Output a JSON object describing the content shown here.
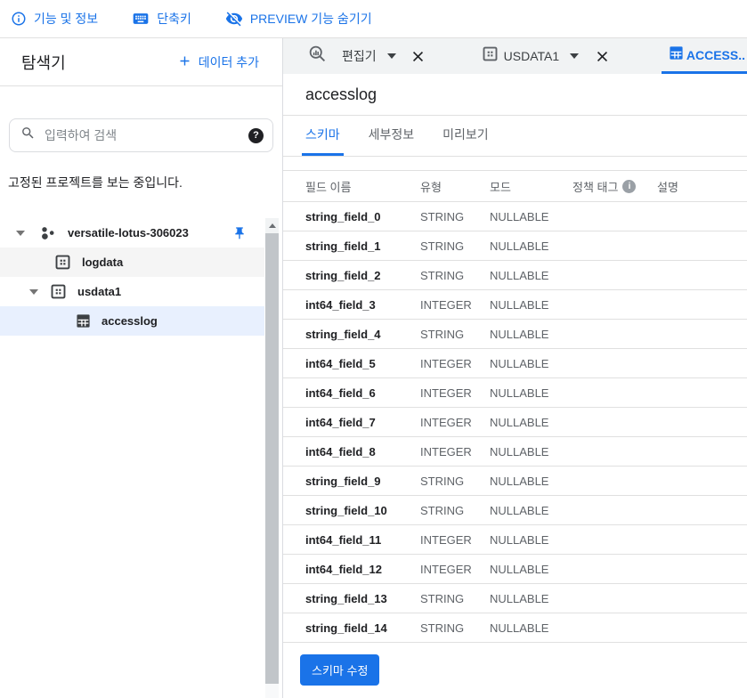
{
  "topbar": {
    "items": [
      {
        "label": "기능 및 정보",
        "icon": "info-icon"
      },
      {
        "label": "단축키",
        "icon": "keyboard-icon"
      },
      {
        "label": "PREVIEW 기능 숨기기",
        "icon": "eye-off-icon"
      }
    ]
  },
  "explorer": {
    "title": "탐색기",
    "add_data_label": "데이터 추가",
    "search": {
      "placeholder": "입력하여 검색"
    },
    "pinned_message": "고정된 프로젝트를 보는 중입니다.",
    "tree": {
      "project_label": "versatile-lotus-306023",
      "dataset_1": "logdata",
      "dataset_2": "usdata1",
      "table_1": "accesslog"
    }
  },
  "workspace_tabs": {
    "editor_label": "편집기",
    "dataset_label": "USDATA1",
    "table_label": "ACCESS.."
  },
  "content": {
    "title": "accesslog",
    "tabs": [
      {
        "label": "스키마",
        "active": true
      },
      {
        "label": "세부정보",
        "active": false
      },
      {
        "label": "미리보기",
        "active": false
      }
    ],
    "schema_table": {
      "headers": [
        "필드 이름",
        "유형",
        "모드",
        "정책 태그",
        "설명"
      ],
      "rows": [
        {
          "name": "string_field_0",
          "type": "STRING",
          "mode": "NULLABLE",
          "policy": "",
          "description": ""
        },
        {
          "name": "string_field_1",
          "type": "STRING",
          "mode": "NULLABLE",
          "policy": "",
          "description": ""
        },
        {
          "name": "string_field_2",
          "type": "STRING",
          "mode": "NULLABLE",
          "policy": "",
          "description": ""
        },
        {
          "name": "int64_field_3",
          "type": "INTEGER",
          "mode": "NULLABLE",
          "policy": "",
          "description": ""
        },
        {
          "name": "string_field_4",
          "type": "STRING",
          "mode": "NULLABLE",
          "policy": "",
          "description": ""
        },
        {
          "name": "int64_field_5",
          "type": "INTEGER",
          "mode": "NULLABLE",
          "policy": "",
          "description": ""
        },
        {
          "name": "int64_field_6",
          "type": "INTEGER",
          "mode": "NULLABLE",
          "policy": "",
          "description": ""
        },
        {
          "name": "int64_field_7",
          "type": "INTEGER",
          "mode": "NULLABLE",
          "policy": "",
          "description": ""
        },
        {
          "name": "int64_field_8",
          "type": "INTEGER",
          "mode": "NULLABLE",
          "policy": "",
          "description": ""
        },
        {
          "name": "string_field_9",
          "type": "STRING",
          "mode": "NULLABLE",
          "policy": "",
          "description": ""
        },
        {
          "name": "string_field_10",
          "type": "STRING",
          "mode": "NULLABLE",
          "policy": "",
          "description": ""
        },
        {
          "name": "int64_field_11",
          "type": "INTEGER",
          "mode": "NULLABLE",
          "policy": "",
          "description": ""
        },
        {
          "name": "int64_field_12",
          "type": "INTEGER",
          "mode": "NULLABLE",
          "policy": "",
          "description": ""
        },
        {
          "name": "string_field_13",
          "type": "STRING",
          "mode": "NULLABLE",
          "policy": "",
          "description": ""
        },
        {
          "name": "string_field_14",
          "type": "STRING",
          "mode": "NULLABLE",
          "policy": "",
          "description": ""
        }
      ]
    },
    "edit_schema_button": "스키마 수정"
  },
  "colors": {
    "accent": "#1a73e8",
    "selected_row_bg": "#e8f0fe",
    "hover_row_bg": "#f5f5f5",
    "tabstrip_bg": "#f1f3f4",
    "border": "#e0e0e0",
    "text_primary": "#202124",
    "text_secondary": "#5f6368"
  }
}
